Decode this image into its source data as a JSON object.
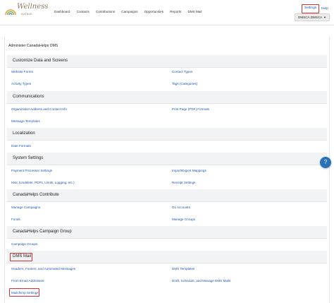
{
  "header": {
    "logo_text": "Wellness",
    "logo_sub": "AVENUE",
    "nav": [
      "Dashboard",
      "Contacts",
      "Contributions",
      "Campaigns",
      "Opportunities",
      "Reports",
      "DMS Mail"
    ],
    "settings_label": "Settings",
    "help_label": "Help",
    "user_menu_label": "DMSCA DMSCA",
    "accent_color": "#d8342c",
    "link_color": "#1a56b0"
  },
  "page": {
    "title": "Administer CanadaHelps DMS"
  },
  "sections": [
    {
      "title": "Customize Data and Screens",
      "links_left": [
        "Website Forms",
        "Activity Types"
      ],
      "links_right": [
        "Contact Types",
        "Tags (Categories)"
      ]
    },
    {
      "title": "Communications",
      "links_left": [
        "Organization Address and Contact Info",
        "Message Templates"
      ],
      "links_right": [
        "Print Page (PDF) Formats"
      ]
    },
    {
      "title": "Localization",
      "links_left": [
        "Date Formats"
      ],
      "links_right": []
    },
    {
      "title": "System Settings",
      "links_left": [
        "Payment Processor Settings",
        "Misc (Undelete, PDFs, Limits, Logging, etc.)"
      ],
      "links_right": [
        "Import/Export Mappings",
        "Receipt Settings"
      ]
    },
    {
      "title": "CanadaHelps Contribute",
      "links_left": [
        "Manage Campaigns",
        "Funds"
      ],
      "links_right": [
        "GL Accounts",
        "Manage Groups"
      ]
    },
    {
      "title": "CanadaHelps Campaign Group",
      "links_left": [
        "Campaign Groups"
      ],
      "links_right": []
    },
    {
      "title": "DMS Mail",
      "links_left": [
        "Headers, Footers, and Automated Messages",
        "From Email Addresses",
        "Mailchimp Settings"
      ],
      "links_right": [
        "DMS Templates",
        "Draft, Schedule, and Manage DMS Mails"
      ]
    }
  ],
  "help_fab_label": "?"
}
